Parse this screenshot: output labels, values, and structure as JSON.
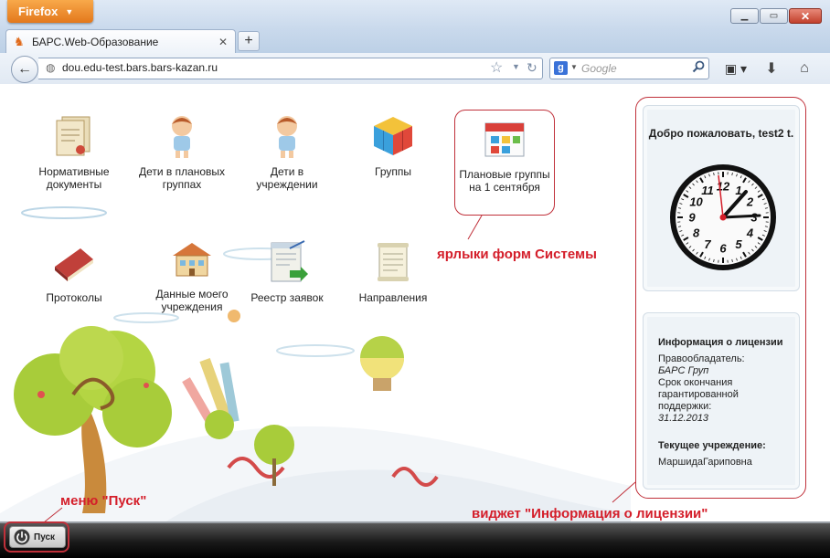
{
  "browser": {
    "app_button_label": "Firefox",
    "tab_title": "БАРС.Web-Образование",
    "url": "dou.edu-test.bars.bars-kazan.ru",
    "search_placeholder": "Google",
    "search_engine_letter": "g"
  },
  "shortcuts": [
    {
      "label": "Нормативные документы",
      "icon": "documents-icon"
    },
    {
      "label": "Дети в плановых группах",
      "icon": "child-icon"
    },
    {
      "label": "Дети в учреждении",
      "icon": "child-icon"
    },
    {
      "label": "Группы",
      "icon": "cube-icon"
    },
    {
      "label": "Плановые группы на 1 сентября",
      "icon": "calendar-icon"
    },
    {
      "label": "Протоколы",
      "icon": "book-icon"
    },
    {
      "label": "Данные моего учреждения",
      "icon": "building-icon"
    },
    {
      "label": "Реестр заявок",
      "icon": "register-icon"
    },
    {
      "label": "Направления",
      "icon": "scroll-icon"
    }
  ],
  "callouts": {
    "shortcuts": "ярлыки форм Системы",
    "widget": "виджет \"Информация о лицензии\"",
    "start_menu": "меню \"Пуск\""
  },
  "widget": {
    "welcome": "Добро пожаловать, test2 t.",
    "clock_numbers": [
      "12",
      "1",
      "2",
      "3",
      "4",
      "5",
      "6",
      "7",
      "8",
      "9",
      "10",
      "11"
    ],
    "license_title": "Информация о лицензии",
    "owner_label": "Правообладатель:",
    "owner_value": "БАРС Груп",
    "expiry_label": "Срок окончания гарантированной поддержки:",
    "expiry_value": "31.12.2013",
    "institution_label": "Текущее учреждение:",
    "institution_value": "МаршидаГариповна"
  },
  "taskbar": {
    "start_label": "Пуск"
  },
  "colors": {
    "accent_red": "#d41e2a",
    "firefox_orange": "#e3781c"
  }
}
